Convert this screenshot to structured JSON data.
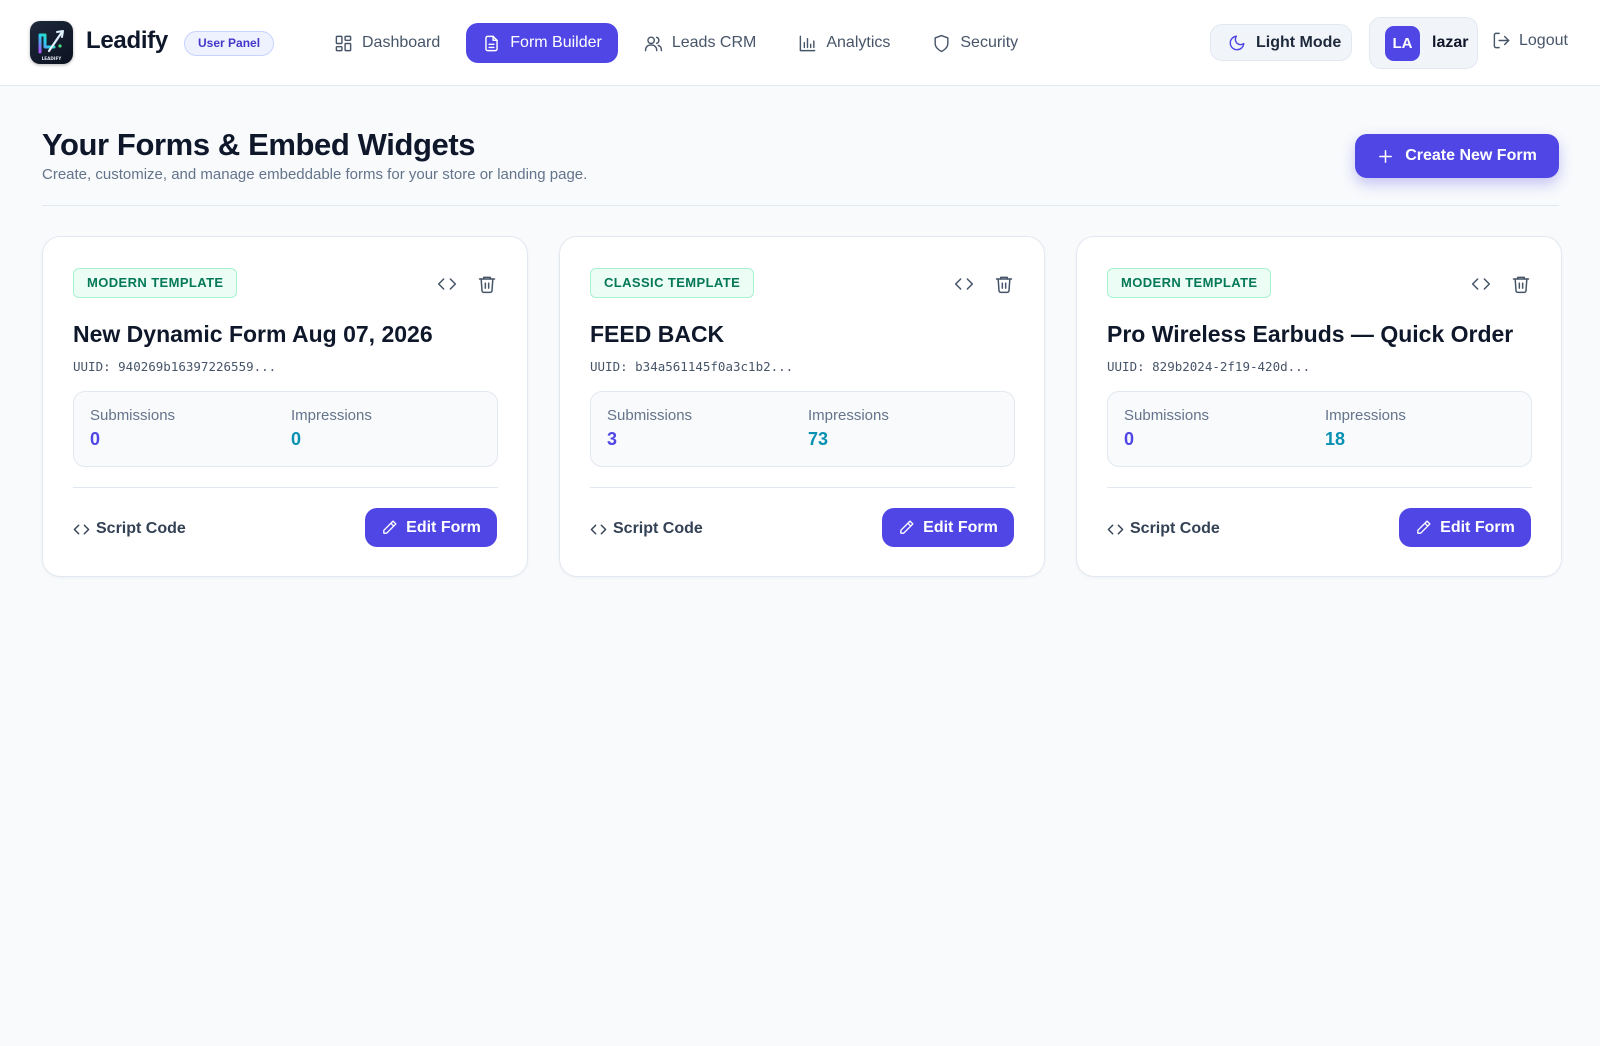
{
  "app": {
    "brand": "Leadify",
    "panel_badge": "User Panel",
    "logo_caption": "LEADIFY"
  },
  "nav": {
    "items": [
      {
        "label": "Dashboard",
        "icon": "dashboard-grid-icon",
        "active": false
      },
      {
        "label": "Form Builder",
        "icon": "document-icon",
        "active": true
      },
      {
        "label": "Leads CRM",
        "icon": "users-icon",
        "active": false
      },
      {
        "label": "Analytics",
        "icon": "bar-chart-icon",
        "active": false
      },
      {
        "label": "Security",
        "icon": "shield-icon",
        "active": false
      }
    ]
  },
  "header": {
    "theme_toggle_label": "Light Mode",
    "user_initials": "LA",
    "username": "lazar",
    "logout_label": "Logout"
  },
  "page": {
    "title": "Your Forms & Embed Widgets",
    "subtitle": "Create, customize, and manage embeddable forms for your store or landing page.",
    "create_button": "Create New Form"
  },
  "labels": {
    "submissions": "Submissions",
    "impressions": "Impressions",
    "script_code": "Script Code",
    "edit_form": "Edit Form"
  },
  "forms": [
    {
      "template": "MODERN TEMPLATE",
      "title": "New Dynamic Form Aug 07, 2026",
      "uuid": "UUID: 940269b16397226559...",
      "submissions": "0",
      "impressions": "0"
    },
    {
      "template": "CLASSIC TEMPLATE",
      "title": "FEED BACK",
      "uuid": "UUID: b34a561145f0a3c1b2...",
      "submissions": "3",
      "impressions": "73"
    },
    {
      "template": "MODERN TEMPLATE",
      "title": "Pro Wireless Earbuds — Quick Order",
      "uuid": "UUID: 829b2024-2f19-420d...",
      "submissions": "0",
      "impressions": "18"
    }
  ],
  "colors": {
    "accent": "#4f46e5",
    "impressions": "#0891b2",
    "badge_green": "#047857",
    "background": "#f8fafc"
  }
}
